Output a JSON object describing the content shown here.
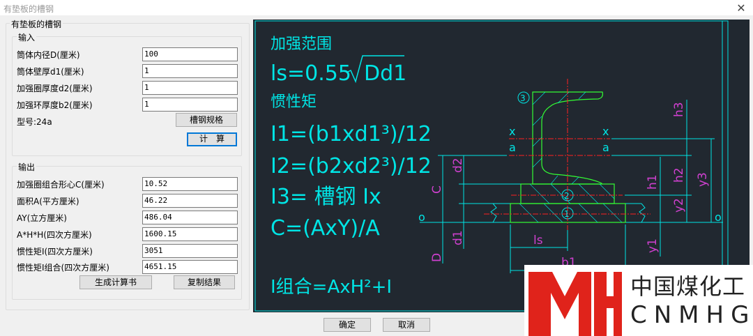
{
  "window": {
    "title": "有垫板的槽钢",
    "close_icon": "close-icon"
  },
  "panel": {
    "group_title": "有垫板的槽钢",
    "input": {
      "title": "输入",
      "fields": [
        {
          "label": "筒体内径D(厘米)",
          "value": "100"
        },
        {
          "label": "筒体壁厚d1(厘米)",
          "value": "1"
        },
        {
          "label": "加强圈厚度d2(厘米)",
          "value": "1"
        },
        {
          "label": "加强环厚度b2(厘米)",
          "value": "1"
        }
      ],
      "model_label": "型号:24a",
      "spec_button": "槽钢规格",
      "calc_button": "计　算"
    },
    "output": {
      "title": "输出",
      "fields": [
        {
          "label": "加强圈组合形心C(厘米)",
          "value": "10.52"
        },
        {
          "label": "面积A(平方厘米)",
          "value": "46.22"
        },
        {
          "label": "AY(立方厘米)",
          "value": "486.04"
        },
        {
          "label": "A*H*H(四次方厘米)",
          "value": "1600.15"
        },
        {
          "label": "惯性矩I(四次方厘米)",
          "value": "3051"
        },
        {
          "label": "惯性矩I组合(四次方厘米)",
          "value": "4651.15"
        }
      ],
      "report_button": "生成计算书",
      "copy_button": "复制结果"
    }
  },
  "drawing": {
    "formulas": {
      "range_title": "加强范围",
      "ls": "ls=0.55",
      "ls_root": "Dd1",
      "inertia_title": "惯性矩",
      "i1": "I1=(b1xd1³)/12",
      "i2": "I2=(b2xd2³)/12",
      "i3": "I3= 槽钢 Ix",
      "c": "C=(AxY)/A",
      "icomb": "I组合=AxH²+I"
    },
    "labels": {
      "x": "x",
      "a": "a",
      "o": "o",
      "c": "C",
      "d2": "d2",
      "d1": "d1",
      "D": "D",
      "ls": "ls",
      "b1": "b1",
      "h1": "h1",
      "h2": "h2",
      "h3": "h3",
      "y1": "y1",
      "y2": "y2",
      "y3": "y3",
      "n1": "1",
      "n2": "2",
      "n3": "3"
    },
    "colors": {
      "bg": "#212830",
      "cyan": "#00e5e5",
      "green": "#33ff33",
      "red": "#ff2020",
      "magenta": "#d040d0"
    }
  },
  "footer": {
    "ok": "确定",
    "cancel": "取消"
  },
  "watermark": {
    "logo": "MH",
    "cn": "中国煤化工",
    "en": "CNMHG"
  }
}
